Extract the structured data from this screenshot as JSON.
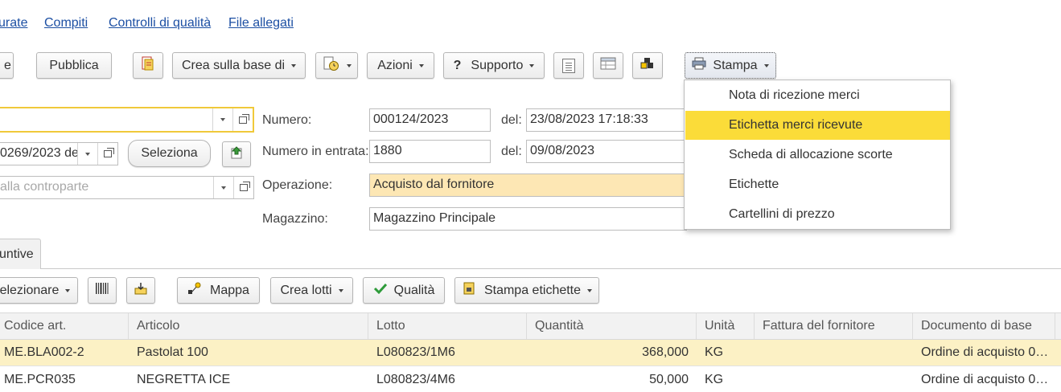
{
  "top_links": [
    "urate",
    "Compiti",
    "Controlli di qualità",
    "File allegati"
  ],
  "toolbar": {
    "cut_left": "e",
    "publish": "Pubblica",
    "create_based_on": "Crea sulla base di",
    "actions": "Azioni",
    "support_q": "?",
    "support": "Supporto",
    "print": "Stampa"
  },
  "print_menu": {
    "items": [
      "Nota di ricezione merci",
      "Etichetta merci ricevute",
      "Scheda di allocazione scorte",
      "Etichette",
      "Cartellini di prezzo"
    ],
    "selected_index": 1
  },
  "form": {
    "field2_value": "0269/2023 de",
    "select_button": "Seleziona",
    "counterparty_placeholder": "alla controparte",
    "number_label": "Numero:",
    "number_value": "000124/2023",
    "date_label": "del:",
    "date_value": "23/08/2023 17:18:33",
    "incoming_number_label": "Numero in entrata:",
    "incoming_number_value": "1880",
    "incoming_date_label": "del:",
    "incoming_date_value": "09/08/2023",
    "operation_label": "Operazione:",
    "operation_value": "Acquisto dal fornitore",
    "warehouse_label": "Magazzino:",
    "warehouse_value": "Magazzino Principale"
  },
  "tabs": {
    "active": "untive"
  },
  "table_toolbar": {
    "select": "elezionare",
    "map": "Mappa",
    "create_lots": "Crea lotti",
    "quality": "Qualità",
    "print_labels": "Stampa etichette"
  },
  "table": {
    "columns": [
      "Codice art.",
      "Articolo",
      "Lotto",
      "Quantità",
      "Unità",
      "Fattura del fornitore",
      "Documento di base"
    ],
    "rows": [
      {
        "code": "ME.BLA002-2",
        "item": "Pastolat 100",
        "lot": "L080823/1M6",
        "qty": "368,000",
        "unit": "KG",
        "invoice": "",
        "base_doc": "Ordine di acquisto 0…"
      },
      {
        "code": "ME.PCR035",
        "item": "NEGRETTA ICE",
        "lot": "L080823/4M6",
        "qty": "50,000",
        "unit": "KG",
        "invoice": "",
        "base_doc": "Ordine di acquisto 0…"
      }
    ]
  },
  "colors": {
    "accent_yellow": "#fbdc39",
    "selected_row": "#fcf1c5",
    "operation_bg": "#fde7b4",
    "link": "#1c4fa3"
  }
}
